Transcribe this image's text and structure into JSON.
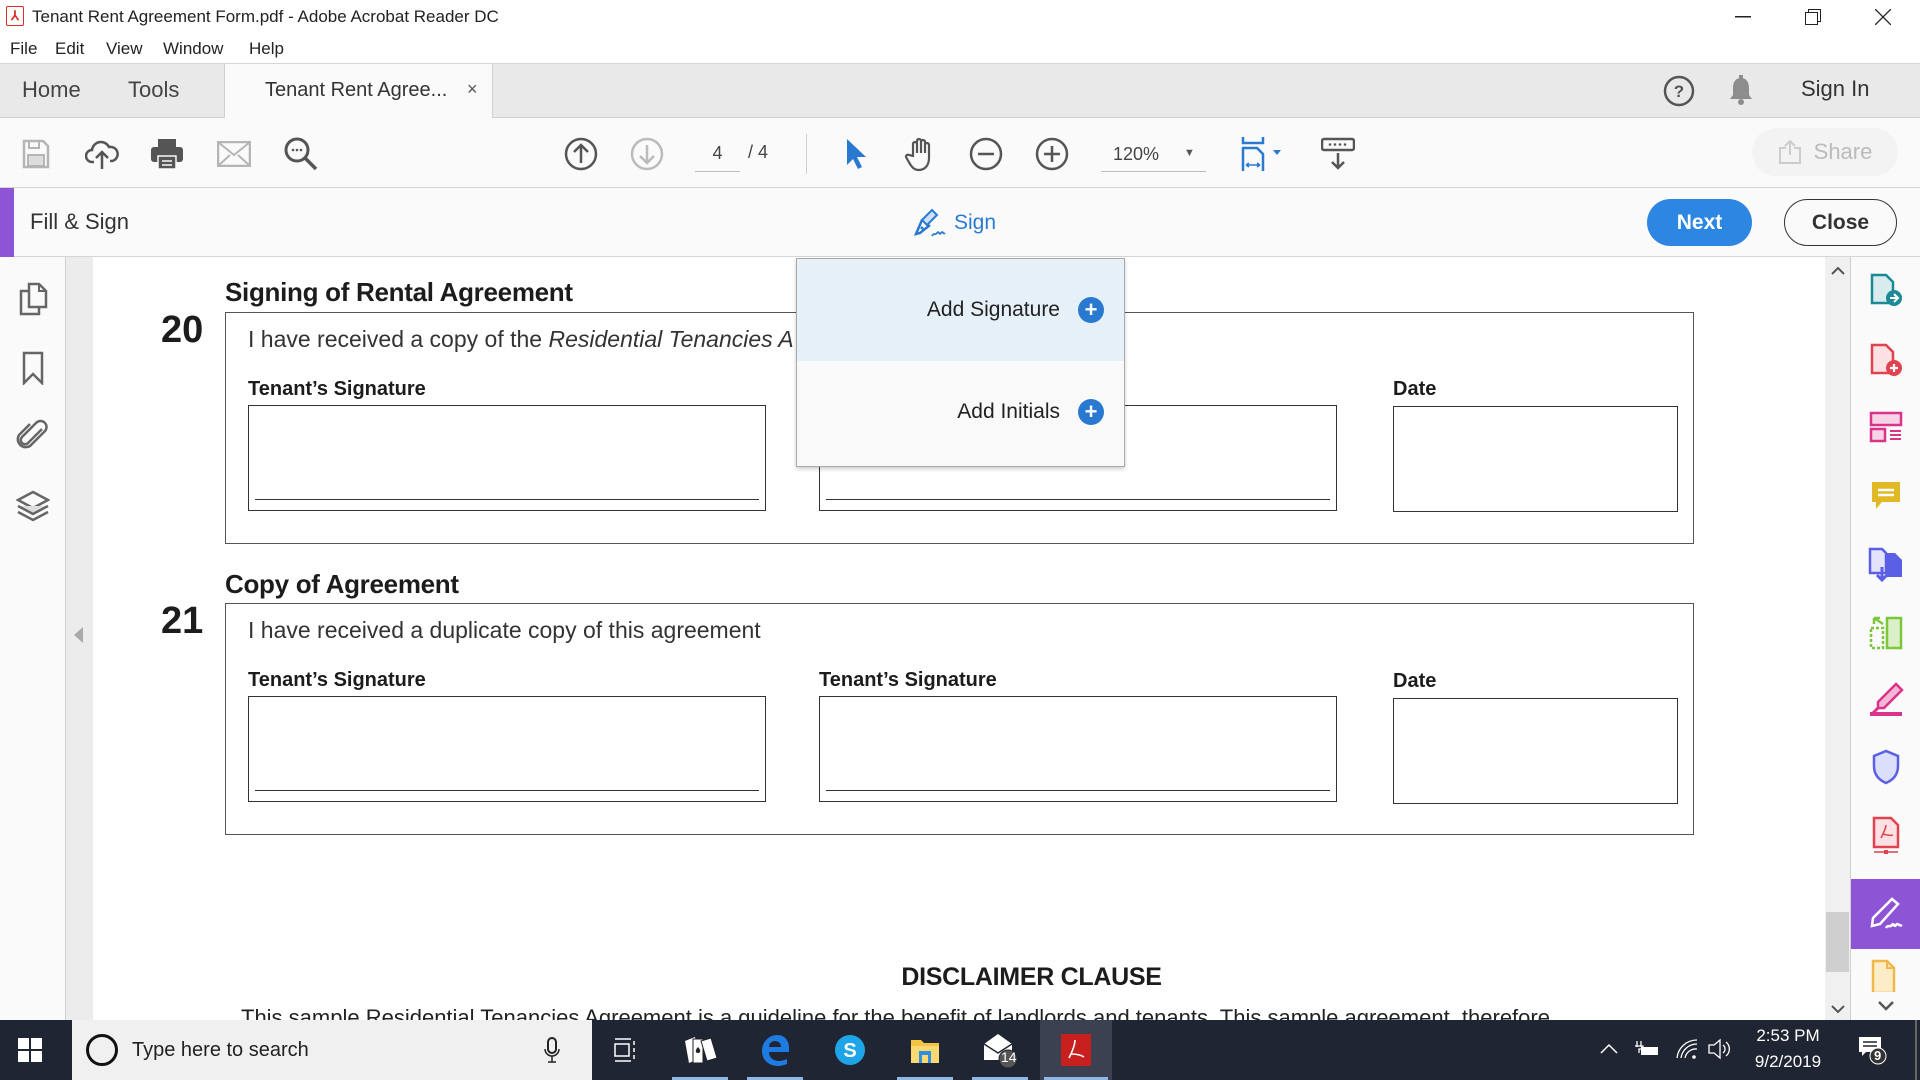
{
  "window": {
    "title": "Tenant Rent Agreement Form.pdf - Adobe Acrobat Reader DC",
    "app_icon": "acrobat-icon",
    "controls": {
      "minimize": "—",
      "restore": "❐",
      "close": "✕"
    }
  },
  "menu": [
    "File",
    "Edit",
    "View",
    "Window",
    "Help"
  ],
  "tabs": {
    "home": "Home",
    "tools": "Tools",
    "document": "Tenant Rent Agree...",
    "document_close": "×",
    "sign_in": "Sign In"
  },
  "toolbar": {
    "page_current": "4",
    "page_total": "/ 4",
    "zoom": "120%",
    "share": "Share"
  },
  "fill_sign": {
    "label": "Fill & Sign",
    "sign": "Sign",
    "next": "Next",
    "close": "Close",
    "accent_color": "#8e54d6"
  },
  "dropdown": {
    "items": [
      {
        "label": "Add Signature",
        "highlighted": true
      },
      {
        "label": "Add Initials",
        "highlighted": false
      }
    ]
  },
  "document": {
    "sections": [
      {
        "number": "20",
        "title": "Signing of Rental Agreement",
        "text_plain": "I have received a copy of the ",
        "text_italic": "Residential Tenancies A",
        "fields": [
          "Tenant’s Signature",
          "",
          "Date"
        ]
      },
      {
        "number": "21",
        "title": "Copy of Agreement",
        "text_plain": "I have received a duplicate copy of this agreement",
        "text_italic": "",
        "fields": [
          "Tenant’s Signature",
          "Tenant’s Signature",
          "Date"
        ]
      }
    ],
    "disclaimer_title": "DISCLAIMER CLAUSE",
    "disclaimer_text": "This sample Residential Tenancies Agreement  is a guideline for the benefit of landlords and tenants. This sample agreement, therefore"
  },
  "taskbar": {
    "search_placeholder": "Type here to search",
    "mail_badge": "14",
    "time": "2:53 PM",
    "date": "9/2/2019",
    "notifications": "9"
  }
}
